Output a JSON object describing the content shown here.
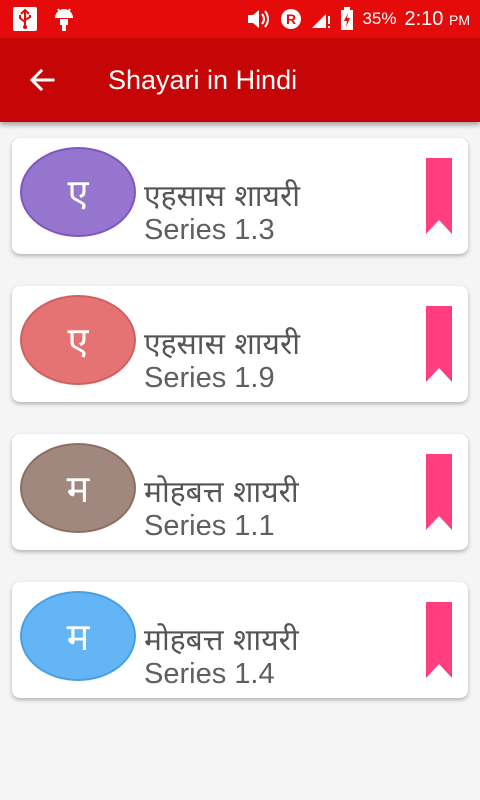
{
  "status_bar": {
    "icons": [
      "usb-icon",
      "android-debug-icon",
      "volume-icon",
      "roaming-icon",
      "signal-icon",
      "battery-charging-icon"
    ],
    "battery": "35%",
    "time": "2:10",
    "ampm": "PM"
  },
  "app_bar": {
    "back_icon": "arrow-left-icon",
    "title": "Shayari in Hindi"
  },
  "items": [
    {
      "letter": "ए",
      "title": "एहसास शायरी",
      "subtitle": "Series 1.3",
      "avatar_color": "#9575cd",
      "avatar_border": "#7e57c2"
    },
    {
      "letter": "ए",
      "title": "एहसास शायरी",
      "subtitle": "Series 1.9",
      "avatar_color": "#e57373",
      "avatar_border": "#d16060"
    },
    {
      "letter": "म",
      "title": "मोहबत्त शायरी",
      "subtitle": "Series 1.1",
      "avatar_color": "#a1887f",
      "avatar_border": "#8d6e63"
    },
    {
      "letter": "म",
      "title": "मोहबत्त शायरी",
      "subtitle": "Series 1.4",
      "avatar_color": "#64b5f6",
      "avatar_border": "#4a9fe0"
    }
  ],
  "colors": {
    "status_bar": "#e50b0b",
    "app_bar": "#c60606",
    "bookmark": "#ff3d7f"
  }
}
